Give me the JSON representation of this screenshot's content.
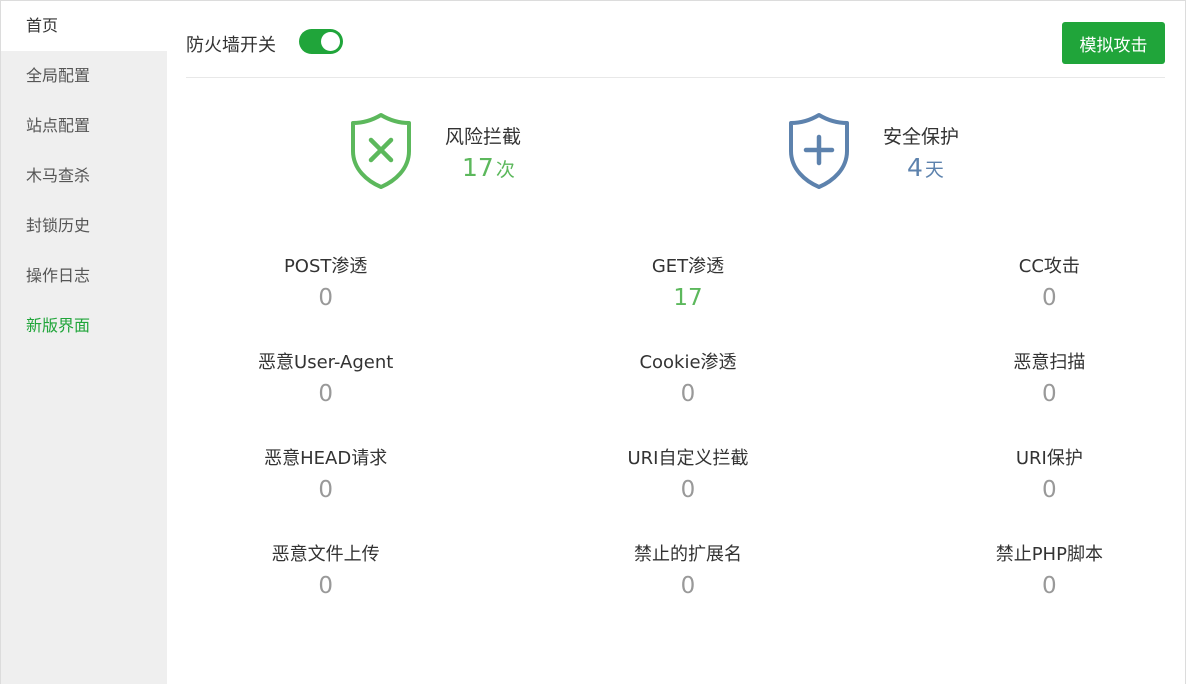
{
  "sidebar": {
    "items": [
      {
        "label": "首页"
      },
      {
        "label": "全局配置"
      },
      {
        "label": "站点配置"
      },
      {
        "label": "木马查杀"
      },
      {
        "label": "封锁历史"
      },
      {
        "label": "操作日志"
      },
      {
        "label": "新版界面"
      }
    ]
  },
  "header": {
    "firewall_label": "防火墙开关",
    "firewall_enabled": true,
    "simulate_button": "模拟攻击"
  },
  "summary": {
    "risk": {
      "title": "风险拦截",
      "value": "17",
      "unit": "次",
      "icon": "shield-x-icon",
      "color": "#5cb85c"
    },
    "safe": {
      "title": "安全保护",
      "value": "4",
      "unit": "天",
      "icon": "shield-plus-icon",
      "color": "#5d82ad"
    }
  },
  "stats": [
    {
      "name": "POST渗透",
      "value": "0"
    },
    {
      "name": "GET渗透",
      "value": "17"
    },
    {
      "name": "CC攻击",
      "value": "0"
    },
    {
      "name": "恶意User-Agent",
      "value": "0"
    },
    {
      "name": "Cookie渗透",
      "value": "0"
    },
    {
      "name": "恶意扫描",
      "value": "0"
    },
    {
      "name": "恶意HEAD请求",
      "value": "0"
    },
    {
      "name": "URI自定义拦截",
      "value": "0"
    },
    {
      "name": "URI保护",
      "value": "0"
    },
    {
      "name": "恶意文件上传",
      "value": "0"
    },
    {
      "name": "禁止的扩展名",
      "value": "0"
    },
    {
      "name": "禁止PHP脚本",
      "value": "0"
    }
  ],
  "colors": {
    "accent": "#20a53a",
    "risk_green": "#5cb85c",
    "safe_blue": "#5d82ad",
    "zero_gray": "#999999"
  }
}
